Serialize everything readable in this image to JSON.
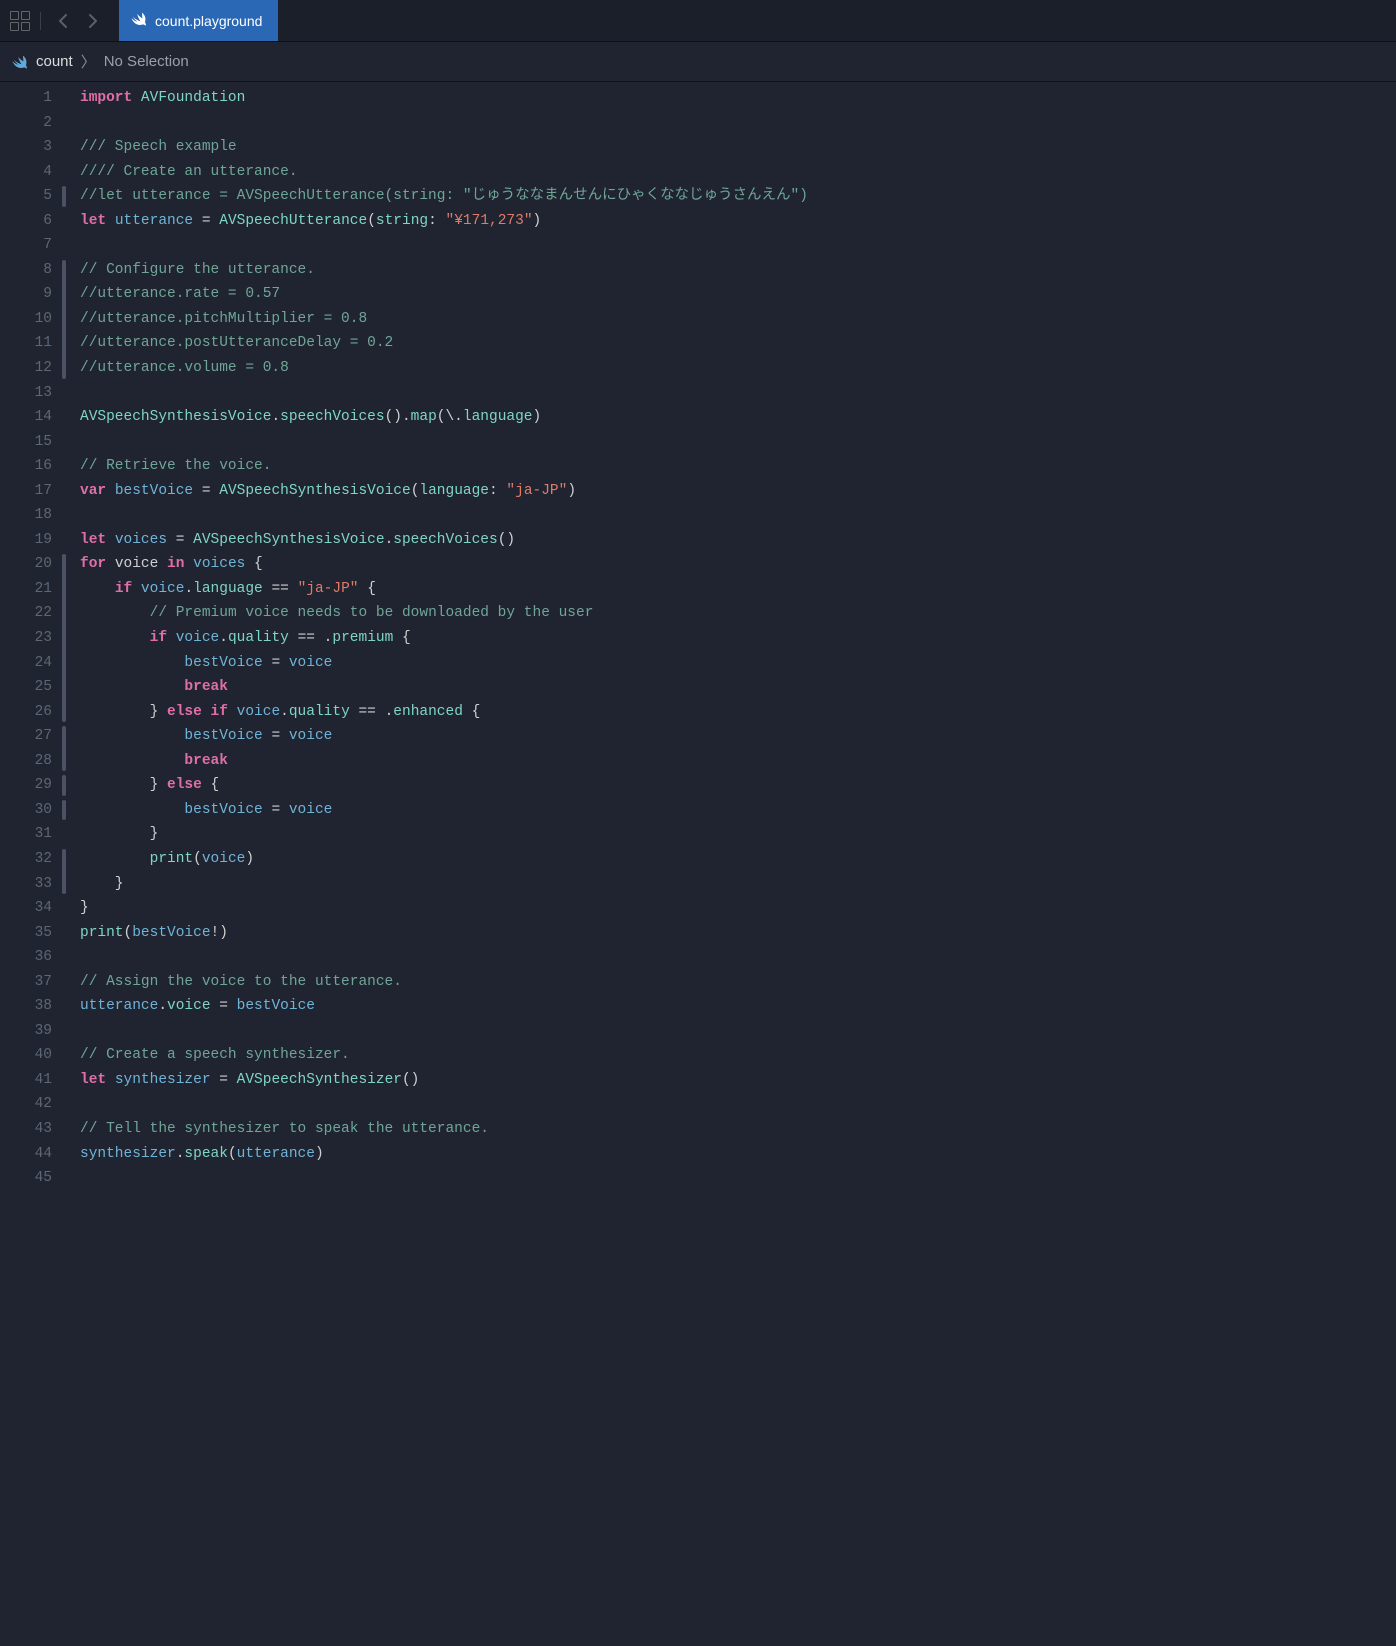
{
  "tab": {
    "title": "count.playground"
  },
  "breadcrumb": {
    "file": "count",
    "selection": "No Selection"
  },
  "gutter": {
    "start": 1,
    "end": 45
  },
  "code": {
    "lines": [
      [
        [
          "keyword",
          "import"
        ],
        [
          "plain",
          " "
        ],
        [
          "type",
          "AVFoundation"
        ]
      ],
      [],
      [
        [
          "doccomment",
          "/// Speech example"
        ]
      ],
      [
        [
          "doccomment",
          "///"
        ],
        [
          "comment",
          "/ Create an utterance."
        ]
      ],
      [
        [
          "comment",
          "//let utterance = AVSpeechUtterance(string: \"じゅうななまんせんにひゃくななじゅうさんえん\")"
        ]
      ],
      [
        [
          "keyword",
          "let"
        ],
        [
          "plain",
          " "
        ],
        [
          "ident",
          "utterance"
        ],
        [
          "plain",
          " = "
        ],
        [
          "type",
          "AVSpeechUtterance"
        ],
        [
          "plain",
          "("
        ],
        [
          "func",
          "string"
        ],
        [
          "plain",
          ": "
        ],
        [
          "string",
          "\"¥171,273\""
        ],
        [
          "plain",
          ")"
        ]
      ],
      [],
      [
        [
          "comment",
          "// Configure the utterance."
        ]
      ],
      [
        [
          "comment",
          "//utterance.rate = 0.57"
        ]
      ],
      [
        [
          "comment",
          "//utterance.pitchMultiplier = 0.8"
        ]
      ],
      [
        [
          "comment",
          "//utterance.postUtteranceDelay = 0.2"
        ]
      ],
      [
        [
          "comment",
          "//utterance.volume = 0.8"
        ]
      ],
      [],
      [
        [
          "type",
          "AVSpeechSynthesisVoice"
        ],
        [
          "plain",
          "."
        ],
        [
          "func",
          "speechVoices"
        ],
        [
          "plain",
          "()."
        ],
        [
          "func",
          "map"
        ],
        [
          "plain",
          "(\\."
        ],
        [
          "property",
          "language"
        ],
        [
          "plain",
          ")"
        ]
      ],
      [],
      [
        [
          "comment",
          "// Retrieve the voice."
        ]
      ],
      [
        [
          "keyword",
          "var"
        ],
        [
          "plain",
          " "
        ],
        [
          "ident",
          "bestVoice"
        ],
        [
          "plain",
          " = "
        ],
        [
          "type",
          "AVSpeechSynthesisVoice"
        ],
        [
          "plain",
          "("
        ],
        [
          "func",
          "language"
        ],
        [
          "plain",
          ": "
        ],
        [
          "string",
          "\"ja-JP\""
        ],
        [
          "plain",
          ")"
        ]
      ],
      [],
      [
        [
          "keyword",
          "let"
        ],
        [
          "plain",
          " "
        ],
        [
          "ident",
          "voices"
        ],
        [
          "plain",
          " = "
        ],
        [
          "type",
          "AVSpeechSynthesisVoice"
        ],
        [
          "plain",
          "."
        ],
        [
          "func",
          "speechVoices"
        ],
        [
          "plain",
          "()"
        ]
      ],
      [
        [
          "keyword",
          "for"
        ],
        [
          "plain",
          " "
        ],
        [
          "plain",
          "voice "
        ],
        [
          "keyword",
          "in"
        ],
        [
          "plain",
          " "
        ],
        [
          "ident",
          "voices"
        ],
        [
          "plain",
          " {"
        ]
      ],
      [
        [
          "plain",
          "    "
        ],
        [
          "keyword",
          "if"
        ],
        [
          "plain",
          " "
        ],
        [
          "ident",
          "voice"
        ],
        [
          "plain",
          "."
        ],
        [
          "property",
          "language"
        ],
        [
          "plain",
          " == "
        ],
        [
          "string",
          "\"ja-JP\""
        ],
        [
          "plain",
          " {"
        ]
      ],
      [
        [
          "plain",
          "        "
        ],
        [
          "comment",
          "// Premium voice needs to be downloaded by the user"
        ]
      ],
      [
        [
          "plain",
          "        "
        ],
        [
          "keyword",
          "if"
        ],
        [
          "plain",
          " "
        ],
        [
          "ident",
          "voice"
        ],
        [
          "plain",
          "."
        ],
        [
          "property",
          "quality"
        ],
        [
          "plain",
          " == ."
        ],
        [
          "enum",
          "premium"
        ],
        [
          "plain",
          " {"
        ]
      ],
      [
        [
          "plain",
          "            "
        ],
        [
          "ident",
          "bestVoice"
        ],
        [
          "plain",
          " = "
        ],
        [
          "ident",
          "voice"
        ]
      ],
      [
        [
          "plain",
          "            "
        ],
        [
          "keyword",
          "break"
        ]
      ],
      [
        [
          "plain",
          "        } "
        ],
        [
          "keyword",
          "else"
        ],
        [
          "plain",
          " "
        ],
        [
          "keyword",
          "if"
        ],
        [
          "plain",
          " "
        ],
        [
          "ident",
          "voice"
        ],
        [
          "plain",
          "."
        ],
        [
          "property",
          "quality"
        ],
        [
          "plain",
          " == ."
        ],
        [
          "enum",
          "enhanced"
        ],
        [
          "plain",
          " {"
        ]
      ],
      [
        [
          "plain",
          "            "
        ],
        [
          "ident",
          "bestVoice"
        ],
        [
          "plain",
          " = "
        ],
        [
          "ident",
          "voice"
        ]
      ],
      [
        [
          "plain",
          "            "
        ],
        [
          "keyword",
          "break"
        ]
      ],
      [
        [
          "plain",
          "        } "
        ],
        [
          "keyword",
          "else"
        ],
        [
          "plain",
          " {"
        ]
      ],
      [
        [
          "plain",
          "            "
        ],
        [
          "ident",
          "bestVoice"
        ],
        [
          "plain",
          " = "
        ],
        [
          "ident",
          "voice"
        ]
      ],
      [
        [
          "plain",
          "        }"
        ]
      ],
      [
        [
          "plain",
          "        "
        ],
        [
          "func",
          "print"
        ],
        [
          "plain",
          "("
        ],
        [
          "ident",
          "voice"
        ],
        [
          "plain",
          ")"
        ]
      ],
      [
        [
          "plain",
          "    }"
        ]
      ],
      [
        [
          "plain",
          "}"
        ]
      ],
      [
        [
          "func",
          "print"
        ],
        [
          "plain",
          "("
        ],
        [
          "ident",
          "bestVoice"
        ],
        [
          "plain",
          "!)"
        ]
      ],
      [],
      [
        [
          "comment",
          "// Assign the voice to the utterance."
        ]
      ],
      [
        [
          "ident",
          "utterance"
        ],
        [
          "plain",
          "."
        ],
        [
          "property",
          "voice"
        ],
        [
          "plain",
          " = "
        ],
        [
          "ident",
          "bestVoice"
        ]
      ],
      [],
      [
        [
          "comment",
          "// Create a speech synthesizer."
        ]
      ],
      [
        [
          "keyword",
          "let"
        ],
        [
          "plain",
          " "
        ],
        [
          "ident",
          "synthesizer"
        ],
        [
          "plain",
          " = "
        ],
        [
          "type",
          "AVSpeechSynthesizer"
        ],
        [
          "plain",
          "()"
        ]
      ],
      [],
      [
        [
          "comment",
          "// Tell the synthesizer to speak the utterance."
        ]
      ],
      [
        [
          "ident",
          "synthesizer"
        ],
        [
          "plain",
          "."
        ],
        [
          "func",
          "speak"
        ],
        [
          "plain",
          "("
        ],
        [
          "ident",
          "utterance"
        ],
        [
          "plain",
          ")"
        ]
      ],
      []
    ]
  },
  "markers": [
    {
      "from": 5,
      "to": 5
    },
    {
      "from": 8,
      "to": 12
    },
    {
      "from": 20,
      "to": 26
    },
    {
      "from": 27,
      "to": 28
    },
    {
      "from": 29,
      "to": 29
    },
    {
      "from": 30,
      "to": 30
    },
    {
      "from": 32,
      "to": 33
    }
  ]
}
